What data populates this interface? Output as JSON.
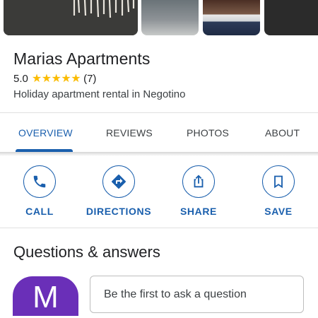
{
  "place": {
    "name": "Marias Apartments",
    "rating": "5.0",
    "stars": "★★★★★",
    "review_count": "(7)",
    "category": "Holiday apartment rental in Negotino"
  },
  "tabs": [
    {
      "label": "OVERVIEW",
      "active": true
    },
    {
      "label": "REVIEWS",
      "active": false
    },
    {
      "label": "PHOTOS",
      "active": false
    },
    {
      "label": "ABOUT",
      "active": false
    }
  ],
  "actions": [
    {
      "label": "CALL",
      "icon": "phone-icon"
    },
    {
      "label": "DIRECTIONS",
      "icon": "directions-icon"
    },
    {
      "label": "SHARE",
      "icon": "share-icon"
    },
    {
      "label": "SAVE",
      "icon": "bookmark-icon"
    }
  ],
  "qa": {
    "heading": "Questions & answers",
    "avatar_letter": "M",
    "ask_placeholder": "Be the first to ask a question"
  },
  "colors": {
    "accent": "#1a5fad",
    "star": "#fbbc04",
    "avatar": "#6a2fb8"
  }
}
